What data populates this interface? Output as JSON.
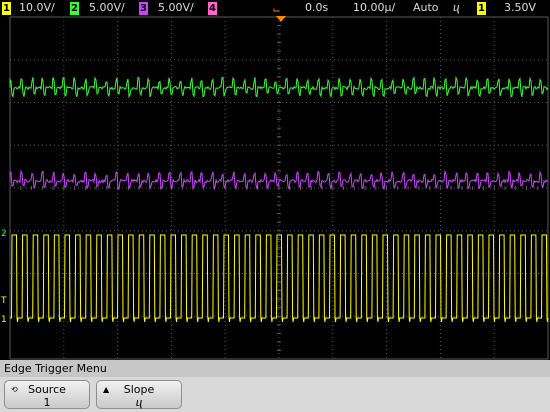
{
  "status_bar": {
    "channels": [
      {
        "num": "1",
        "scale": "10.0V/",
        "color": "#ffff00"
      },
      {
        "num": "2",
        "scale": "5.00V/",
        "color": "#33ff33"
      },
      {
        "num": "3",
        "scale": "5.00V/",
        "color": "#cc44ff"
      },
      {
        "num": "4",
        "scale": "",
        "color": "#ff66cc"
      }
    ],
    "trigger_icon": "trigger-position-marker",
    "delay": "0.0s",
    "timebase": "10.00µ/",
    "mode": "Auto",
    "slope_symbol": "ⴗ",
    "trigger_source": "1",
    "trigger_level": "3.50V"
  },
  "markers": {
    "ch2_label": "2",
    "ch1_label": "1",
    "trigger_label": "T"
  },
  "menu": {
    "title": "Edge Trigger Menu",
    "softkeys": [
      {
        "label": "Source",
        "value": "1",
        "icon": "rotary-knob-icon"
      },
      {
        "label": "Slope",
        "value": "ⴗ",
        "icon": "menu-up-icon"
      }
    ]
  },
  "colors": {
    "ch1": "#ffff00",
    "ch2": "#33ff33",
    "ch3": "#cc44ff",
    "grid": "#5a5a5a",
    "trigger": "#ff8800"
  }
}
